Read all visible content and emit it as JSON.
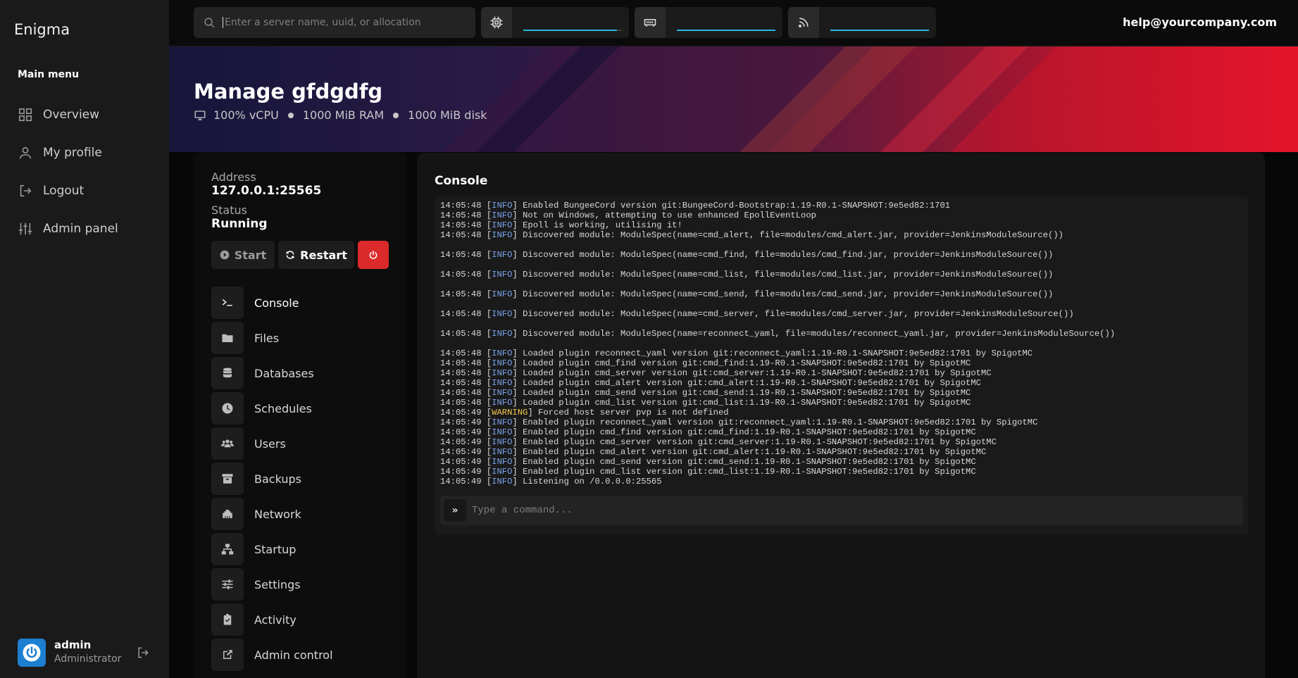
{
  "sidebar": {
    "brand": "Enigma",
    "menu_title": "Main menu",
    "items": [
      {
        "label": "Overview",
        "icon": "grid-icon"
      },
      {
        "label": "My profile",
        "icon": "user-icon"
      },
      {
        "label": "Logout",
        "icon": "logout-icon"
      },
      {
        "label": "Admin panel",
        "icon": "sliders-icon"
      }
    ],
    "user": {
      "name": "admin",
      "role": "Administrator"
    }
  },
  "topbar": {
    "search_placeholder": "Enter a server name, uuid, or allocation",
    "stats": [
      {
        "icon": "cpu-icon",
        "fill_fraction": 0.95
      },
      {
        "icon": "memory-icon",
        "fill_fraction": 1.0
      },
      {
        "icon": "network-icon",
        "fill_fraction": 1.0
      }
    ],
    "help_email": "help@yourcompany.com"
  },
  "header": {
    "title": "Manage gfdgdfg",
    "cpu": "100% vCPU",
    "ram": "1000 MiB RAM",
    "disk": "1000 MiB disk"
  },
  "server": {
    "address_label": "Address",
    "address": "127.0.0.1:25565",
    "status_label": "Status",
    "status": "Running",
    "start_label": "Start",
    "restart_label": "Restart",
    "nav": [
      {
        "label": "Console",
        "icon": "terminal-icon"
      },
      {
        "label": "Files",
        "icon": "folder-icon"
      },
      {
        "label": "Databases",
        "icon": "database-icon"
      },
      {
        "label": "Schedules",
        "icon": "clock-icon"
      },
      {
        "label": "Users",
        "icon": "users-icon"
      },
      {
        "label": "Backups",
        "icon": "archive-icon"
      },
      {
        "label": "Network",
        "icon": "ethernet-icon"
      },
      {
        "label": "Startup",
        "icon": "sitemap-icon"
      },
      {
        "label": "Settings",
        "icon": "sliders-icon"
      },
      {
        "label": "Activity",
        "icon": "clipboard-check-icon"
      },
      {
        "label": "Admin control",
        "icon": "external-link-icon"
      }
    ]
  },
  "console": {
    "title": "Console",
    "command_placeholder": "Type a command...",
    "lines": [
      {
        "time": "14:05:48",
        "tag": "INFO",
        "msg": "Enabled BungeeCord version git:BungeeCord-Bootstrap:1.19-R0.1-SNAPSHOT:9e5ed82:1701",
        "gap": false
      },
      {
        "time": "14:05:48",
        "tag": "INFO",
        "msg": "Not on Windows, attempting to use enhanced EpollEventLoop",
        "gap": false
      },
      {
        "time": "14:05:48",
        "tag": "INFO",
        "msg": "Epoll is working, utilising it!",
        "gap": false
      },
      {
        "time": "14:05:48",
        "tag": "INFO",
        "msg": "Discovered module: ModuleSpec(name=cmd_alert, file=modules/cmd_alert.jar, provider=JenkinsModuleSource())",
        "gap": true
      },
      {
        "time": "14:05:48",
        "tag": "INFO",
        "msg": "Discovered module: ModuleSpec(name=cmd_find, file=modules/cmd_find.jar, provider=JenkinsModuleSource())",
        "gap": true
      },
      {
        "time": "14:05:48",
        "tag": "INFO",
        "msg": "Discovered module: ModuleSpec(name=cmd_list, file=modules/cmd_list.jar, provider=JenkinsModuleSource())",
        "gap": true
      },
      {
        "time": "14:05:48",
        "tag": "INFO",
        "msg": "Discovered module: ModuleSpec(name=cmd_send, file=modules/cmd_send.jar, provider=JenkinsModuleSource())",
        "gap": true
      },
      {
        "time": "14:05:48",
        "tag": "INFO",
        "msg": "Discovered module: ModuleSpec(name=cmd_server, file=modules/cmd_server.jar, provider=JenkinsModuleSource())",
        "gap": true
      },
      {
        "time": "14:05:48",
        "tag": "INFO",
        "msg": "Discovered module: ModuleSpec(name=reconnect_yaml, file=modules/reconnect_yaml.jar, provider=JenkinsModuleSource())",
        "gap": true
      },
      {
        "time": "14:05:48",
        "tag": "INFO",
        "msg": "Loaded plugin reconnect_yaml version git:reconnect_yaml:1.19-R0.1-SNAPSHOT:9e5ed82:1701 by SpigotMC",
        "gap": false
      },
      {
        "time": "14:05:48",
        "tag": "INFO",
        "msg": "Loaded plugin cmd_find version git:cmd_find:1.19-R0.1-SNAPSHOT:9e5ed82:1701 by SpigotMC",
        "gap": false
      },
      {
        "time": "14:05:48",
        "tag": "INFO",
        "msg": "Loaded plugin cmd_server version git:cmd_server:1.19-R0.1-SNAPSHOT:9e5ed82:1701 by SpigotMC",
        "gap": false
      },
      {
        "time": "14:05:48",
        "tag": "INFO",
        "msg": "Loaded plugin cmd_alert version git:cmd_alert:1.19-R0.1-SNAPSHOT:9e5ed82:1701 by SpigotMC",
        "gap": false
      },
      {
        "time": "14:05:48",
        "tag": "INFO",
        "msg": "Loaded plugin cmd_send version git:cmd_send:1.19-R0.1-SNAPSHOT:9e5ed82:1701 by SpigotMC",
        "gap": false
      },
      {
        "time": "14:05:48",
        "tag": "INFO",
        "msg": "Loaded plugin cmd_list version git:cmd_list:1.19-R0.1-SNAPSHOT:9e5ed82:1701 by SpigotMC",
        "gap": false
      },
      {
        "time": "14:05:49",
        "tag": "WARNING",
        "msg": "Forced host server pvp is not defined",
        "gap": false
      },
      {
        "time": "14:05:49",
        "tag": "INFO",
        "msg": "Enabled plugin reconnect_yaml version git:reconnect_yaml:1.19-R0.1-SNAPSHOT:9e5ed82:1701 by SpigotMC",
        "gap": false
      },
      {
        "time": "14:05:49",
        "tag": "INFO",
        "msg": "Enabled plugin cmd_find version git:cmd_find:1.19-R0.1-SNAPSHOT:9e5ed82:1701 by SpigotMC",
        "gap": false
      },
      {
        "time": "14:05:49",
        "tag": "INFO",
        "msg": "Enabled plugin cmd_server version git:cmd_server:1.19-R0.1-SNAPSHOT:9e5ed82:1701 by SpigotMC",
        "gap": false
      },
      {
        "time": "14:05:49",
        "tag": "INFO",
        "msg": "Enabled plugin cmd_alert version git:cmd_alert:1.19-R0.1-SNAPSHOT:9e5ed82:1701 by SpigotMC",
        "gap": false
      },
      {
        "time": "14:05:49",
        "tag": "INFO",
        "msg": "Enabled plugin cmd_send version git:cmd_send:1.19-R0.1-SNAPSHOT:9e5ed82:1701 by SpigotMC",
        "gap": false
      },
      {
        "time": "14:05:49",
        "tag": "INFO",
        "msg": "Enabled plugin cmd_list version git:cmd_list:1.19-R0.1-SNAPSHOT:9e5ed82:1701 by SpigotMC",
        "gap": false
      },
      {
        "time": "14:05:49",
        "tag": "INFO",
        "msg": "Listening on /0.0.0.0:25565",
        "gap": false
      }
    ]
  },
  "colors": {
    "accent": "#27b9de",
    "danger": "#dc2a2a",
    "info_tag": "#7aa3ee",
    "warning_tag": "#f2c94c"
  }
}
